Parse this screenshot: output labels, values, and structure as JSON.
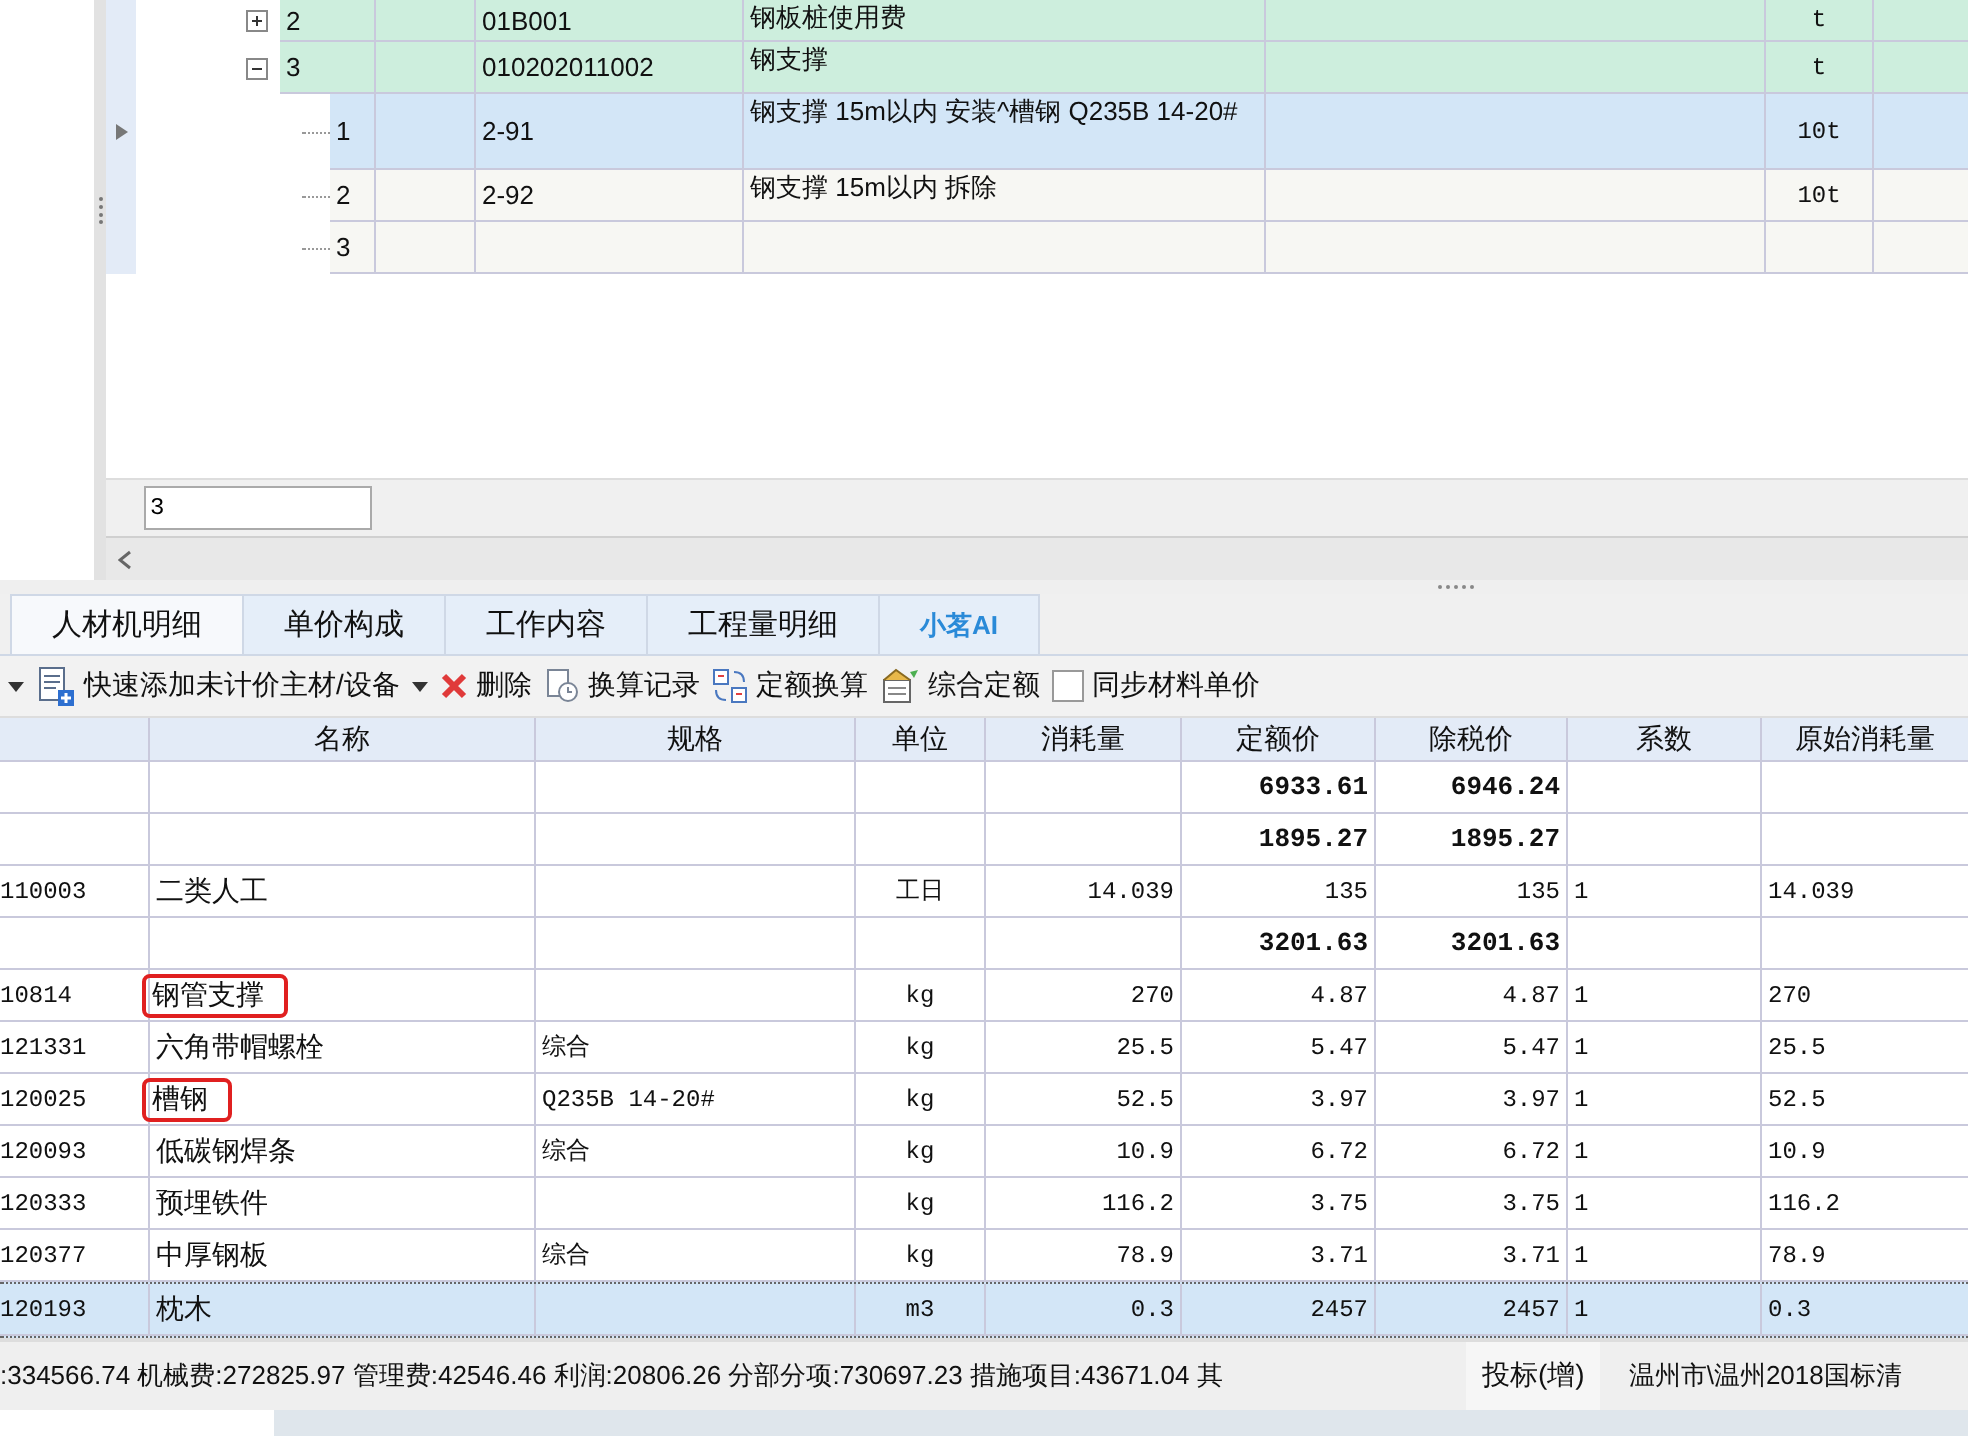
{
  "tree_grid": {
    "rows": [
      {
        "kind": "group",
        "seq": "2",
        "code": "01B001",
        "name": "钢板桩使用费",
        "unit": "t",
        "expanded": false,
        "selected": false
      },
      {
        "kind": "group",
        "seq": "3",
        "code": "010202011002",
        "name": "钢支撑",
        "unit": "t",
        "expanded": true,
        "selected": false
      },
      {
        "kind": "item",
        "seq": "1",
        "code": "2-91",
        "name": "钢支撑 15m以内 安装^槽钢 Q235B 14-20#",
        "unit": "10t",
        "selected": true
      },
      {
        "kind": "item",
        "seq": "2",
        "code": "2-92",
        "name": "钢支撑 15m以内 拆除",
        "unit": "10t",
        "selected": false
      },
      {
        "kind": "item",
        "seq": "3",
        "selected": false
      }
    ]
  },
  "row_field": {
    "value": "3"
  },
  "tabs": [
    {
      "label": "人材机明细",
      "selected": true
    },
    {
      "label": "单价构成",
      "selected": false
    },
    {
      "label": "工作内容",
      "selected": false
    },
    {
      "label": "工程量明细",
      "selected": false
    },
    {
      "label": "小茗AI",
      "selected": false,
      "kind": "ai"
    }
  ],
  "toolbar": [
    {
      "kind": "caret"
    },
    {
      "kind": "add",
      "label": "快速添加未计价主材/设备"
    },
    {
      "kind": "caret"
    },
    {
      "kind": "delete",
      "label": "删除"
    },
    {
      "kind": "history",
      "label": "换算记录"
    },
    {
      "kind": "convert",
      "label": "定额换算"
    },
    {
      "kind": "quota",
      "label": "综合定额"
    },
    {
      "kind": "checkbox",
      "label": "同步材料单价",
      "checked": false
    }
  ],
  "detail_table": {
    "columns": [
      "名称",
      "规格",
      "单位",
      "消耗量",
      "定额价",
      "除税价",
      "系数",
      "原始消耗量"
    ],
    "rows": [
      {
        "kind": "subtotal",
        "price": "6933.61",
        "net_price": "6946.24",
        "selected": false
      },
      {
        "kind": "subtotal",
        "price": "1895.27",
        "net_price": "1895.27",
        "selected": false
      },
      {
        "kind": "item",
        "code": "110003",
        "name": "二类人工",
        "unit": "工日",
        "qty": "14.039",
        "price": "135",
        "net_price": "135",
        "factor": "1",
        "orig_qty": "14.039",
        "selected": false,
        "highlighted": false
      },
      {
        "kind": "subtotal",
        "price": "3201.63",
        "net_price": "3201.63",
        "selected": false
      },
      {
        "kind": "item",
        "code": "10814",
        "name": "钢管支撑",
        "unit": "kg",
        "qty": "270",
        "price": "4.87",
        "net_price": "4.87",
        "factor": "1",
        "orig_qty": "270",
        "selected": false,
        "highlighted": true
      },
      {
        "kind": "item",
        "code": "121331",
        "name": "六角带帽螺栓",
        "spec": "综合",
        "unit": "kg",
        "qty": "25.5",
        "price": "5.47",
        "net_price": "5.47",
        "factor": "1",
        "orig_qty": "25.5",
        "selected": false,
        "highlighted": false
      },
      {
        "kind": "item",
        "code": "120025",
        "name": "槽钢",
        "spec": "Q235B 14-20#",
        "unit": "kg",
        "qty": "52.5",
        "price": "3.97",
        "net_price": "3.97",
        "factor": "1",
        "orig_qty": "52.5",
        "selected": false,
        "highlighted": true
      },
      {
        "kind": "item",
        "code": "120093",
        "name": "低碳钢焊条",
        "spec": "综合",
        "unit": "kg",
        "qty": "10.9",
        "price": "6.72",
        "net_price": "6.72",
        "factor": "1",
        "orig_qty": "10.9",
        "selected": false,
        "highlighted": false
      },
      {
        "kind": "item",
        "code": "120333",
        "name": "预埋铁件",
        "unit": "kg",
        "qty": "116.2",
        "price": "3.75",
        "net_price": "3.75",
        "factor": "1",
        "orig_qty": "116.2",
        "selected": false,
        "highlighted": false
      },
      {
        "kind": "item",
        "code": "120377",
        "name": "中厚钢板",
        "spec": "综合",
        "unit": "kg",
        "qty": "78.9",
        "price": "3.71",
        "net_price": "3.71",
        "factor": "1",
        "orig_qty": "78.9",
        "selected": false,
        "highlighted": false
      },
      {
        "kind": "item",
        "code": "120193",
        "name": "枕木",
        "unit": "m3",
        "qty": "0.3",
        "price": "2457",
        "net_price": "2457",
        "factor": "1",
        "orig_qty": "0.3",
        "selected": true,
        "highlighted": false
      }
    ]
  },
  "status_bar": {
    "totals": ":334566.74 机械费:272825.97 管理费:42546.46 利润:20806.26 分部分项:730697.23 措施项目:43671.04 其",
    "mode": "投标(增)",
    "path": "温州市\\温州2018国标清"
  }
}
